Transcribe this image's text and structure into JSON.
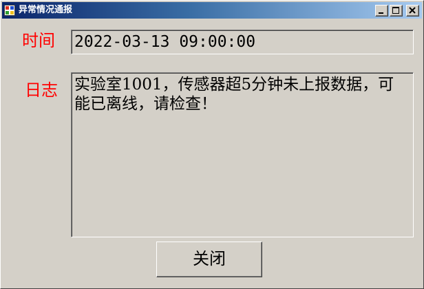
{
  "window": {
    "title": "异常情况通报",
    "app_icon": "app-icon",
    "controls": {
      "minimize_icon": "minimize-icon",
      "maximize_icon": "maximize-icon",
      "close_icon": "close-icon"
    }
  },
  "fields": {
    "time_label": "时间",
    "time_value": "2022-03-13 09:00:00",
    "log_label": "日志",
    "log_value": "实验室1001，传感器超5分钟未上报数据，可能已离线，请检查！"
  },
  "actions": {
    "close_label": "关闭"
  },
  "colors": {
    "label_color": "#ff0000",
    "background": "#d4d0c8",
    "titlebar_start": "#0a246a",
    "titlebar_end": "#a6caf0"
  }
}
